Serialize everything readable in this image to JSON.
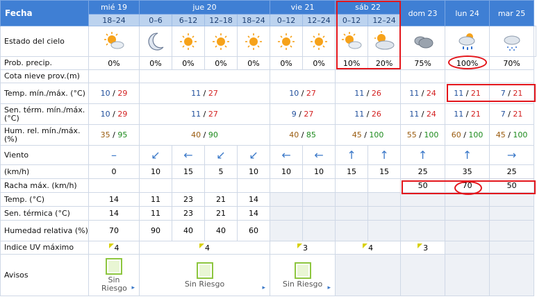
{
  "header": {
    "fecha_label": "Fecha",
    "days": [
      {
        "label": "mié 19",
        "periods": [
          "18–24"
        ]
      },
      {
        "label": "jue 20",
        "periods": [
          "0–6",
          "6–12",
          "12–18",
          "18–24"
        ]
      },
      {
        "label": "vie 21",
        "periods": [
          "0–12",
          "12–24"
        ]
      },
      {
        "label": "sáb 22",
        "periods": [
          "0–12",
          "12–24"
        ]
      },
      {
        "label": "dom 23",
        "periods": []
      },
      {
        "label": "lun 24",
        "periods": []
      },
      {
        "label": "mar 25",
        "periods": []
      }
    ]
  },
  "labels": {
    "sky": "Estado del cielo",
    "precip": "Prob. precip.",
    "snow": "Cota nieve prov.(m)",
    "temp_minmax": "Temp. mín./máx. (°C)",
    "sens_minmax": "Sen. térm. mín./máx. (°C)",
    "hum_minmax": "Hum. rel. mín./máx. (%)",
    "wind": "Viento",
    "wind_unit": "(km/h)",
    "gust": "Racha máx. (km/h)",
    "temp": "Temp. (°C)",
    "sens": "Sen. térmica (°C)",
    "humidity": "Humedad relativa (%)",
    "uv": "Indice UV máximo",
    "avisos": "Avisos"
  },
  "sky_icons": [
    "sun-cloud-icon",
    "moon-icon",
    "sun-icon",
    "sun-icon",
    "sun-icon",
    "sun-icon",
    "sun-cloud-icon",
    "sun-cloud-icon",
    "dark-cloud-icon",
    "rain-cloud-icon",
    "drizzle-cloud-icon",
    "rain-cloud-icon"
  ],
  "precip": [
    "0%",
    "0%",
    "0%",
    "0%",
    "0%",
    "0%",
    "0%",
    "10%",
    "20%",
    "75%",
    "100%",
    "70%"
  ],
  "temp_minmax": [
    {
      "min": "10",
      "max": "29"
    },
    {
      "min": "11",
      "max": "27"
    },
    {
      "min": "10",
      "max": "27"
    },
    {
      "min": "11",
      "max": "26"
    },
    {
      "min": "11",
      "max": "24"
    },
    {
      "min": "11",
      "max": "21"
    },
    {
      "min": "7",
      "max": "21"
    }
  ],
  "sens_minmax": [
    {
      "min": "10",
      "max": "29"
    },
    {
      "min": "11",
      "max": "27"
    },
    {
      "min": "9",
      "max": "27"
    },
    {
      "min": "11",
      "max": "26"
    },
    {
      "min": "11",
      "max": "24"
    },
    {
      "min": "11",
      "max": "21"
    },
    {
      "min": "7",
      "max": "21"
    }
  ],
  "hum_minmax": [
    {
      "min": "35",
      "max": "95"
    },
    {
      "min": "40",
      "max": "90"
    },
    {
      "min": "40",
      "max": "85"
    },
    {
      "min": "45",
      "max": "100"
    },
    {
      "min": "55",
      "max": "100"
    },
    {
      "min": "60",
      "max": "100"
    },
    {
      "min": "45",
      "max": "100"
    }
  ],
  "wind_dirs": [
    "calm-dash-icon",
    "arrow-down-left-icon",
    "arrow-left-icon",
    "arrow-down-left-icon",
    "arrow-down-left-icon",
    "arrow-left-icon",
    "arrow-left-icon",
    "arrow-up-icon",
    "arrow-up-icon",
    "arrow-up-icon",
    "arrow-up-icon",
    "arrow-right-icon"
  ],
  "wind_glyphs": [
    "–",
    "↙",
    "←",
    "↙",
    "↙",
    "←",
    "←",
    "↑",
    "↑",
    "↑",
    "↑",
    "→"
  ],
  "wind_speed": [
    "0",
    "10",
    "15",
    "5",
    "10",
    "10",
    "10",
    "15",
    "15",
    "25",
    "35",
    "25"
  ],
  "gust": [
    "50",
    "70",
    "50"
  ],
  "temp": [
    "14",
    "11",
    "23",
    "21",
    "14"
  ],
  "sens": [
    "14",
    "11",
    "23",
    "21",
    "14"
  ],
  "humidity": [
    "70",
    "90",
    "40",
    "40",
    "60"
  ],
  "uv": [
    "4",
    "4",
    "3",
    "4",
    "3"
  ],
  "avisos": {
    "mie": "Sin Riesgo",
    "jue": "Sin Riesgo",
    "vie": "Sin Riesgo"
  },
  "colors": {
    "header_blue": "#3f7fd4",
    "sub_header": "#bcd3ef",
    "highlight_red": "#e3161c",
    "min_blue": "#1f4e9b",
    "max_red": "#d32020"
  }
}
